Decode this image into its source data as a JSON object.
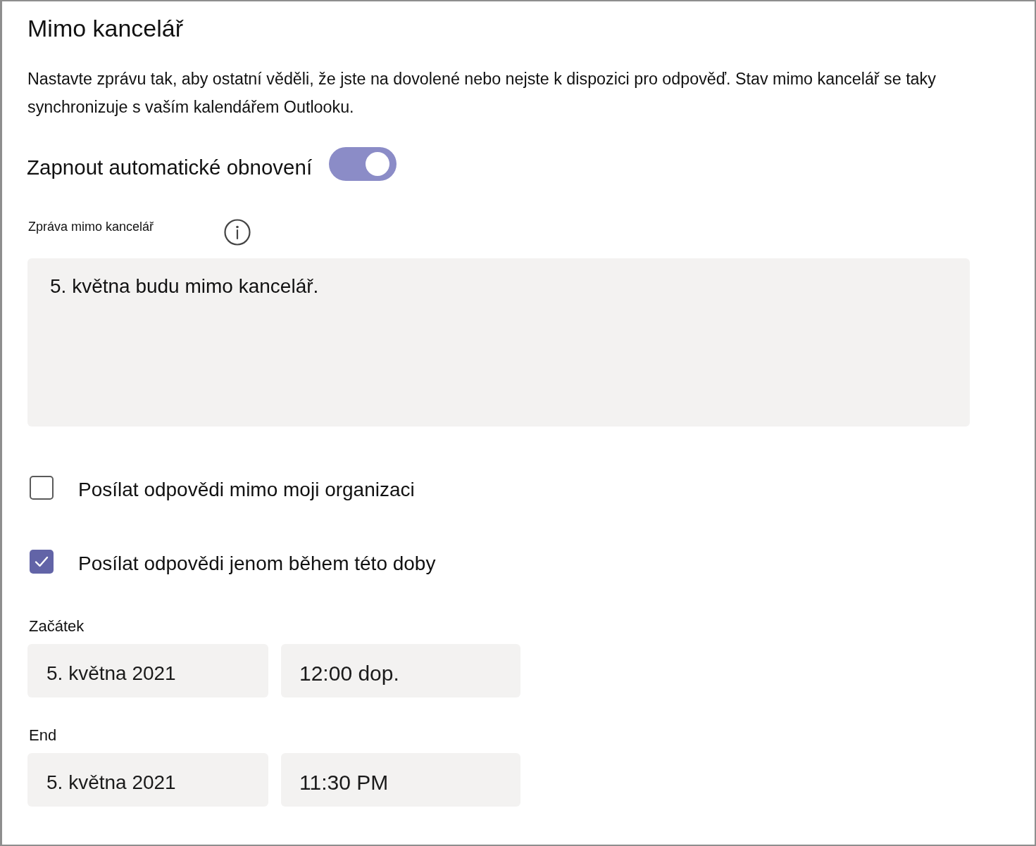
{
  "title": "Mimo kancelář",
  "description": "Nastavte zprávu tak, aby ostatní věděli, že jste na dovolené nebo nejste k dispozici pro odpověď. Stav mimo kancelář se taky synchronizuje s vaším kalendářem Outlooku.",
  "auto_reply": {
    "label": "Zapnout automatické obnovení",
    "on": true
  },
  "message": {
    "label": "Zpráva mimo kancelář",
    "value": "5. května budu mimo kancelář."
  },
  "options": [
    {
      "label": "Posílat odpovědi mimo moji organizaci",
      "checked": false
    },
    {
      "label": "Posílat odpovědi jenom během této doby",
      "checked": true
    }
  ],
  "schedule": [
    {
      "label": "Začátek",
      "date": "5. května 2021",
      "time": "12:00 dop."
    },
    {
      "label": "End",
      "date": "5. května 2021",
      "time": "11:30 PM"
    }
  ]
}
